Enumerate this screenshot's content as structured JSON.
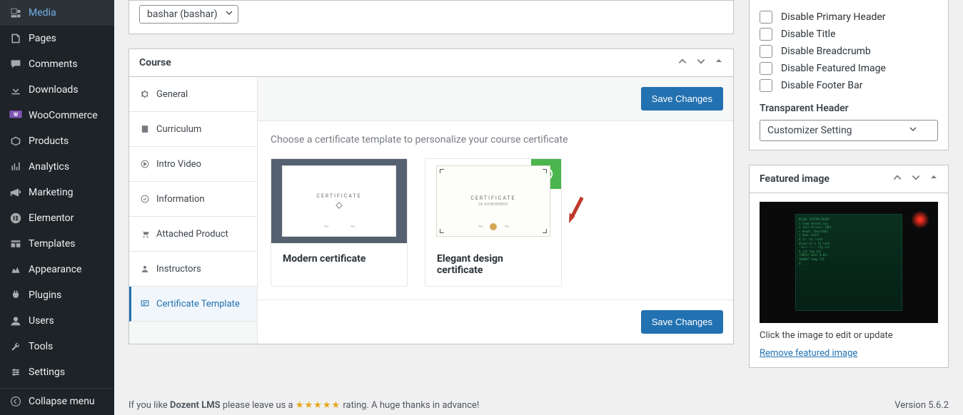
{
  "sidebar": {
    "items": [
      {
        "label": "Media",
        "icon": "media-icon"
      },
      {
        "label": "Pages",
        "icon": "page-icon"
      },
      {
        "label": "Comments",
        "icon": "comment-icon"
      },
      {
        "label": "Downloads",
        "icon": "download-icon"
      },
      {
        "label": "WooCommerce",
        "icon": "woo-icon"
      },
      {
        "label": "Products",
        "icon": "product-icon"
      },
      {
        "label": "Analytics",
        "icon": "analytics-icon"
      },
      {
        "label": "Marketing",
        "icon": "marketing-icon"
      },
      {
        "label": "Elementor",
        "icon": "elementor-icon"
      },
      {
        "label": "Templates",
        "icon": "templates-icon"
      },
      {
        "label": "Appearance",
        "icon": "appearance-icon"
      },
      {
        "label": "Plugins",
        "icon": "plugins-icon"
      },
      {
        "label": "Users",
        "icon": "users-icon"
      },
      {
        "label": "Tools",
        "icon": "tools-icon"
      },
      {
        "label": "Settings",
        "icon": "settings-icon"
      }
    ],
    "collapse": "Collapse menu"
  },
  "author": {
    "selected": "bashar (bashar)"
  },
  "panel": {
    "title": "Course",
    "tabs": {
      "general": "General",
      "curriculum": "Curriculum",
      "intro": "Intro Video",
      "info": "Information",
      "attached": "Attached Product",
      "instructors": "Instructors",
      "certificate": "Certificate Template"
    },
    "save_top": "Save Changes",
    "save_bottom": "Save Changes",
    "description": "Choose a certificate template to personalize your course certificate",
    "certs": {
      "modern": "Modern certificate",
      "elegant": "Elegant design certificate"
    },
    "doc": {
      "title": "CERTIFICATE",
      "subtitle": "OF ACHIEVEMENT"
    }
  },
  "right": {
    "disable": {
      "primary_header": "Disable Primary Header",
      "title": "Disable Title",
      "breadcrumb": "Disable Breadcrumb",
      "featured": "Disable Featured Image",
      "footer": "Disable Footer Bar"
    },
    "transparent_label": "Transparent Header",
    "transparent_value": "Customizer Setting",
    "featured": {
      "title": "Featured image",
      "hint": "Click the image to edit or update",
      "remove": "Remove featured image"
    }
  },
  "footer": {
    "text_before": "If you like ",
    "product": "Dozent LMS",
    "text_mid": " please leave us a ",
    "stars": "★★★★★",
    "text_after": " rating. A huge thanks in advance!",
    "version": "Version 5.6.2"
  }
}
